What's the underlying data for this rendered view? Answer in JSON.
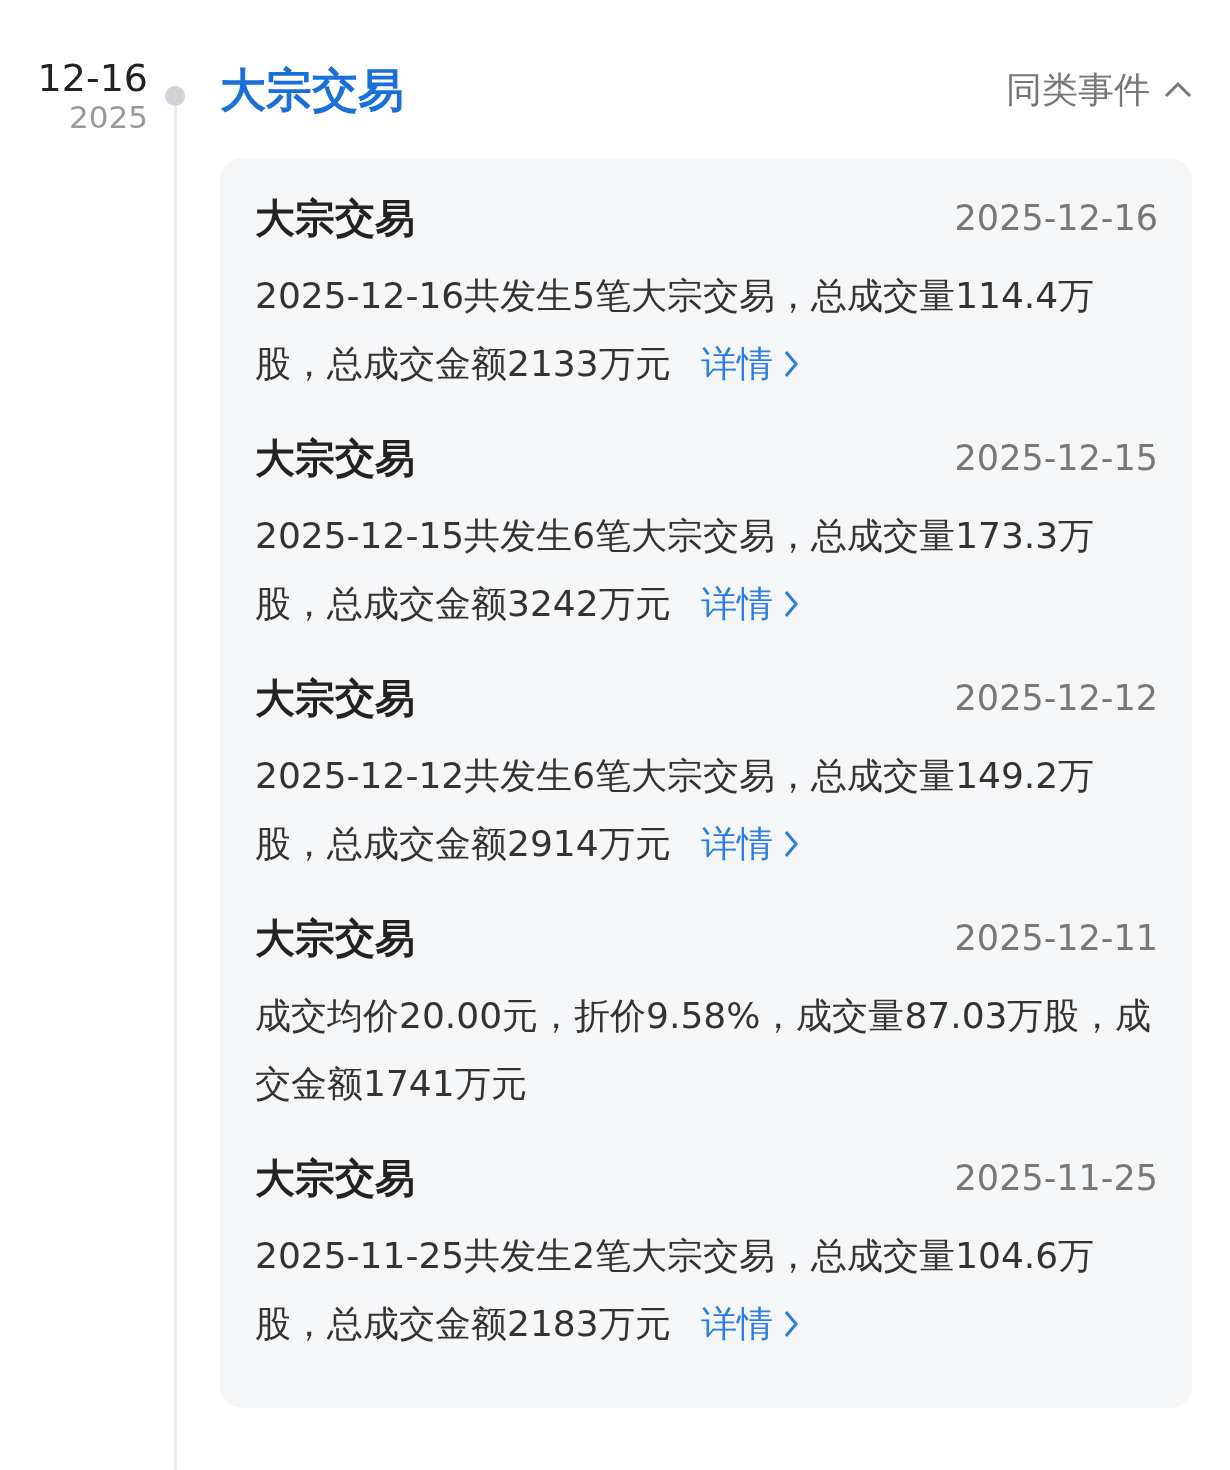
{
  "timeline_date": {
    "day": "12-16",
    "year": "2025"
  },
  "event": {
    "title": "大宗交易",
    "similar_label": "同类事件",
    "expanded": true
  },
  "items": [
    {
      "title": "大宗交易",
      "date": "2025-12-16",
      "text": "2025-12-16共发生5笔大宗交易，总成交量114.4万股，总成交金额2133万元",
      "link": "详情"
    },
    {
      "title": "大宗交易",
      "date": "2025-12-15",
      "text": "2025-12-15共发生6笔大宗交易，总成交量173.3万股，总成交金额3242万元",
      "link": "详情"
    },
    {
      "title": "大宗交易",
      "date": "2025-12-12",
      "text": "2025-12-12共发生6笔大宗交易，总成交量149.2万股，总成交金额2914万元",
      "link": "详情"
    },
    {
      "title": "大宗交易",
      "date": "2025-12-11",
      "text": "成交均价20.00元，折价9.58%，成交量87.03万股，成交金额1741万元"
    },
    {
      "title": "大宗交易",
      "date": "2025-11-25",
      "text": "2025-11-25共发生2笔大宗交易，总成交量104.6万股，总成交金额2183万元",
      "link": "详情"
    }
  ]
}
